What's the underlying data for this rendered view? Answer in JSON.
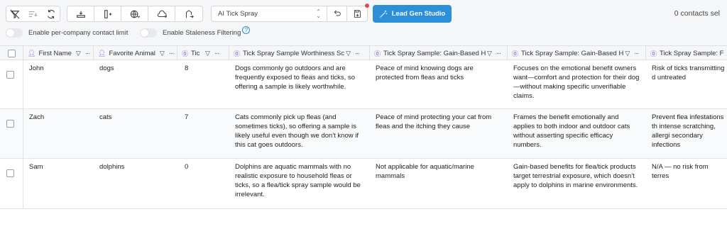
{
  "toolbar": {
    "select_value": "AI Tick Spray",
    "lead_gen_label": "Lead Gen Studio",
    "contacts_label": "0 contacts sel"
  },
  "toggles": {
    "per_company_label": "Enable per-company contact limit",
    "staleness_label": "Enable Staleness Filtering",
    "help_glyph": "?"
  },
  "columns": [
    {
      "label": "First Name"
    },
    {
      "label": "Favorite Animal"
    },
    {
      "label": "Tic"
    },
    {
      "label": "Tick Spray Sample Worthiness Sc"
    },
    {
      "label": "Tick Spray Sample: Gain-Based H"
    },
    {
      "label": "Tick Spray Sample: Gain-Based H"
    },
    {
      "label": "Tick Spray Sample: F"
    }
  ],
  "rows": [
    {
      "first_name": "John",
      "animal": "dogs",
      "score": "8",
      "worthiness": "Dogs commonly go outdoors and are frequently exposed to fleas and ticks, so offering a sample is likely worthwhile.",
      "gain1": "Peace of mind knowing dogs are protected from fleas and ticks",
      "gain2": "Focuses on the emotional benefit owners want—comfort and protection for their dog—without making specific unverifiable claims.",
      "fear": "Risk of ticks transmitting d untreated"
    },
    {
      "first_name": "Zach",
      "animal": "cats",
      "score": "7",
      "worthiness": "Cats commonly pick up fleas (and sometimes ticks), so offering a sample is likely useful even though we don't know if this cat goes outdoors.",
      "gain1": "Peace of mind protecting your cat from fleas and the itching they cause",
      "gain2": "Frames the benefit emotionally and applies to both indoor and outdoor cats without asserting specific efficacy numbers.",
      "fear": "Prevent flea infestations th intense scratching, allergi secondary infections"
    },
    {
      "first_name": "Sam",
      "animal": "dolphins",
      "score": "0",
      "worthiness": "Dolphins are aquatic mammals with no realistic exposure to household fleas or ticks, so a flea/tick spray sample would be irrelevant.",
      "gain1": "Not applicable for aquatic/marine mammals",
      "gain2": "Gain-based benefits for flea/tick products target terrestrial exposure, which doesn't apply to dolphins in marine environments.",
      "fear": "N/A — no risk from terres"
    }
  ]
}
